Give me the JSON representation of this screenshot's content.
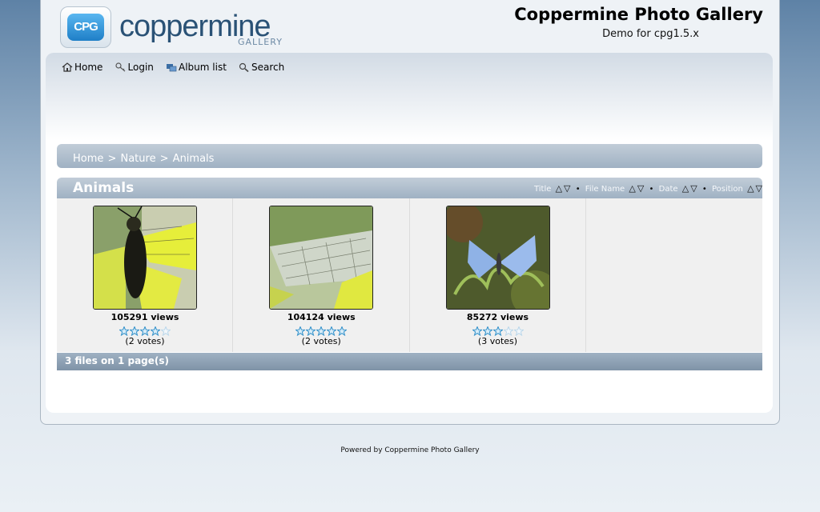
{
  "header": {
    "logo_text": "coppermine",
    "logo_sub": "GALLERY",
    "logo_badge": "CPG",
    "site_title": "Coppermine Photo Gallery",
    "site_description": "Demo for cpg1.5.x"
  },
  "nav": [
    {
      "label": "Home",
      "icon": "home-icon"
    },
    {
      "label": "Login",
      "icon": "key-icon"
    },
    {
      "label": "Album list",
      "icon": "album-list-icon"
    },
    {
      "label": "Search",
      "icon": "search-icon"
    }
  ],
  "breadcrumb": {
    "home": "Home",
    "sep": ">",
    "category": "Nature",
    "album": "Animals"
  },
  "album": {
    "title": "Animals",
    "sort": {
      "title": "Title",
      "file_name": "File Name",
      "date": "Date",
      "position": "Position"
    }
  },
  "thumbnails": [
    {
      "views": "105291 views",
      "rating": 4,
      "votes": "(2 votes)"
    },
    {
      "views": "104124 views",
      "rating": 5,
      "votes": "(2 votes)"
    },
    {
      "views": "85272 views",
      "rating": 3,
      "votes": "(3 votes)"
    }
  ],
  "footer": {
    "summary": "3 files on 1 page(s)",
    "powered_by": "Powered by Coppermine Photo Gallery"
  },
  "colors": {
    "bar": "#9fb1c3",
    "star_filled": "#2f8fc9",
    "star_empty": "#b9d6ea"
  }
}
